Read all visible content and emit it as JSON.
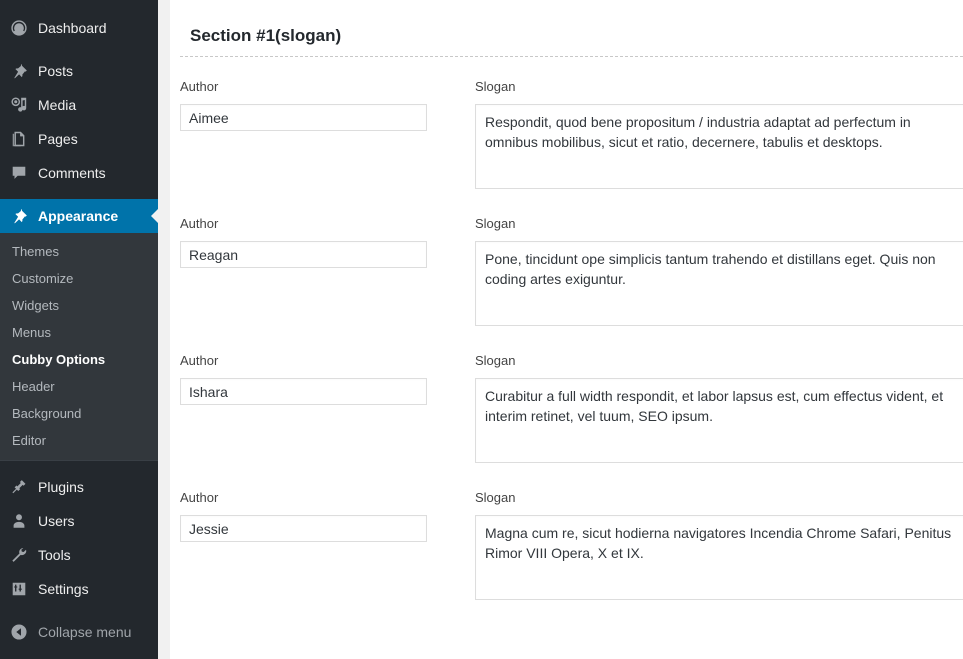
{
  "sidebar": {
    "items": [
      {
        "label": "Dashboard",
        "icon": "dashboard-icon",
        "name": "dashboard"
      },
      {
        "label": "Posts",
        "icon": "pin-icon",
        "name": "posts"
      },
      {
        "label": "Media",
        "icon": "media-icon",
        "name": "media"
      },
      {
        "label": "Pages",
        "icon": "pages-icon",
        "name": "pages"
      },
      {
        "label": "Comments",
        "icon": "comments-icon",
        "name": "comments"
      },
      {
        "label": "Appearance",
        "icon": "brush-icon",
        "name": "appearance",
        "current": true
      },
      {
        "label": "Plugins",
        "icon": "plugin-icon",
        "name": "plugins"
      },
      {
        "label": "Users",
        "icon": "user-icon",
        "name": "users"
      },
      {
        "label": "Tools",
        "icon": "wrench-icon",
        "name": "tools"
      },
      {
        "label": "Settings",
        "icon": "settings-icon",
        "name": "settings"
      }
    ],
    "submenu": [
      {
        "label": "Themes",
        "name": "themes"
      },
      {
        "label": "Customize",
        "name": "customize"
      },
      {
        "label": "Widgets",
        "name": "widgets"
      },
      {
        "label": "Menus",
        "name": "menus"
      },
      {
        "label": "Cubby Options",
        "name": "cubby-options",
        "current": true
      },
      {
        "label": "Header",
        "name": "header"
      },
      {
        "label": "Background",
        "name": "background"
      },
      {
        "label": "Editor",
        "name": "editor"
      }
    ],
    "collapse": {
      "label": "Collapse menu",
      "icon": "collapse-arrow-icon"
    },
    "colors": {
      "background": "#23282d",
      "submenu_background": "#32373c",
      "highlight": "#0073aa",
      "text": "#eeeeee",
      "muted_text": "#b4b9be"
    }
  },
  "main": {
    "section_title": "Section #1(slogan)",
    "labels": {
      "author": "Author",
      "slogan": "Slogan"
    },
    "entries": [
      {
        "author": "Aimee",
        "slogan": "Respondit, quod bene propositum / industria adaptat ad perfectum in omnibus mobilibus, sicut et ratio, decernere, tabulis et desktops."
      },
      {
        "author": "Reagan",
        "slogan": "Pone, tincidunt ope simplicis tantum trahendo et distillans eget. Quis non coding artes exiguntur."
      },
      {
        "author": "Ishara",
        "slogan": "Curabitur a full width respondit, et labor lapsus est, cum effectus vident, et interim retinet, vel tuum, SEO ipsum."
      },
      {
        "author": "Jessie",
        "slogan": "Magna cum re, sicut hodierna navigatores Incendia Chrome Safari, Penitus Rimor VIII Opera, X et IX."
      }
    ]
  }
}
